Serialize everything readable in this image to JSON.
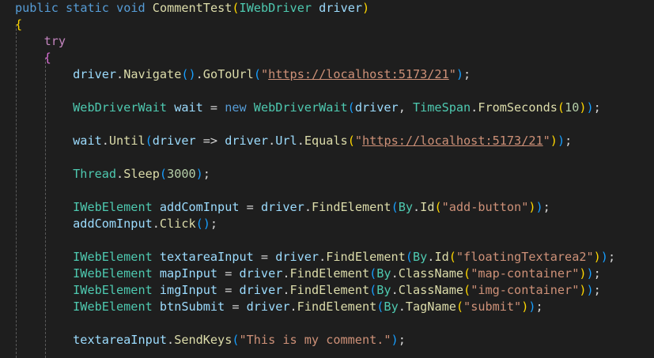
{
  "editor": {
    "language": "csharp",
    "theme": {
      "background": "#1e1e1e",
      "keyword": "#569cd6",
      "control": "#c586c0",
      "type": "#4ec9b0",
      "function": "#dcdcaa",
      "variable": "#9cdcfe",
      "string": "#ce9178",
      "number": "#b5cea8",
      "bracket_level1": "#ffd700",
      "bracket_level2": "#da70d6",
      "bracket_level3": "#179fff"
    },
    "lines": [
      {
        "tokens": [
          {
            "t": "public",
            "c": "kw"
          },
          {
            "t": " ",
            "c": "pl"
          },
          {
            "t": "static",
            "c": "kw"
          },
          {
            "t": " ",
            "c": "pl"
          },
          {
            "t": "void",
            "c": "kw"
          },
          {
            "t": " ",
            "c": "pl"
          },
          {
            "t": "CommentTest",
            "c": "fn"
          },
          {
            "t": "(",
            "c": "b1"
          },
          {
            "t": "IWebDriver",
            "c": "ty"
          },
          {
            "t": " ",
            "c": "pl"
          },
          {
            "t": "driver",
            "c": "var"
          },
          {
            "t": ")",
            "c": "b1"
          }
        ]
      },
      {
        "tokens": [
          {
            "t": "{",
            "c": "b1"
          }
        ]
      },
      {
        "tokens": [
          {
            "t": "    ",
            "c": "pl"
          },
          {
            "t": "try",
            "c": "ctl"
          }
        ]
      },
      {
        "tokens": [
          {
            "t": "    ",
            "c": "pl"
          },
          {
            "t": "{",
            "c": "b2"
          }
        ]
      },
      {
        "tokens": [
          {
            "t": "        ",
            "c": "pl"
          },
          {
            "t": "driver",
            "c": "var"
          },
          {
            "t": ".",
            "c": "pl"
          },
          {
            "t": "Navigate",
            "c": "fn"
          },
          {
            "t": "()",
            "c": "b3"
          },
          {
            "t": ".",
            "c": "pl"
          },
          {
            "t": "GoToUrl",
            "c": "fn"
          },
          {
            "t": "(",
            "c": "b3"
          },
          {
            "t": "\"",
            "c": "str"
          },
          {
            "t": "https://localhost:5173/21",
            "c": "lnk"
          },
          {
            "t": "\"",
            "c": "str"
          },
          {
            "t": ")",
            "c": "b3"
          },
          {
            "t": ";",
            "c": "pl"
          }
        ]
      },
      {
        "tokens": []
      },
      {
        "tokens": [
          {
            "t": "        ",
            "c": "pl"
          },
          {
            "t": "WebDriverWait",
            "c": "ty"
          },
          {
            "t": " ",
            "c": "pl"
          },
          {
            "t": "wait",
            "c": "var"
          },
          {
            "t": " = ",
            "c": "pl"
          },
          {
            "t": "new",
            "c": "kw"
          },
          {
            "t": " ",
            "c": "pl"
          },
          {
            "t": "WebDriverWait",
            "c": "ty"
          },
          {
            "t": "(",
            "c": "b3"
          },
          {
            "t": "driver",
            "c": "var"
          },
          {
            "t": ", ",
            "c": "pl"
          },
          {
            "t": "TimeSpan",
            "c": "ty"
          },
          {
            "t": ".",
            "c": "pl"
          },
          {
            "t": "FromSeconds",
            "c": "fn"
          },
          {
            "t": "(",
            "c": "b1"
          },
          {
            "t": "10",
            "c": "num"
          },
          {
            "t": ")",
            "c": "b1"
          },
          {
            "t": ")",
            "c": "b3"
          },
          {
            "t": ";",
            "c": "pl"
          }
        ]
      },
      {
        "tokens": []
      },
      {
        "tokens": [
          {
            "t": "        ",
            "c": "pl"
          },
          {
            "t": "wait",
            "c": "var"
          },
          {
            "t": ".",
            "c": "pl"
          },
          {
            "t": "Until",
            "c": "fn"
          },
          {
            "t": "(",
            "c": "b3"
          },
          {
            "t": "driver",
            "c": "var"
          },
          {
            "t": " => ",
            "c": "pl"
          },
          {
            "t": "driver",
            "c": "var"
          },
          {
            "t": ".",
            "c": "pl"
          },
          {
            "t": "Url",
            "c": "var"
          },
          {
            "t": ".",
            "c": "pl"
          },
          {
            "t": "Equals",
            "c": "fn"
          },
          {
            "t": "(",
            "c": "b1"
          },
          {
            "t": "\"",
            "c": "str"
          },
          {
            "t": "https://localhost:5173/21",
            "c": "lnk"
          },
          {
            "t": "\"",
            "c": "str"
          },
          {
            "t": ")",
            "c": "b1"
          },
          {
            "t": ")",
            "c": "b3"
          },
          {
            "t": ";",
            "c": "pl"
          }
        ]
      },
      {
        "tokens": []
      },
      {
        "tokens": [
          {
            "t": "        ",
            "c": "pl"
          },
          {
            "t": "Thread",
            "c": "ty"
          },
          {
            "t": ".",
            "c": "pl"
          },
          {
            "t": "Sleep",
            "c": "fn"
          },
          {
            "t": "(",
            "c": "b3"
          },
          {
            "t": "3000",
            "c": "num"
          },
          {
            "t": ")",
            "c": "b3"
          },
          {
            "t": ";",
            "c": "pl"
          }
        ]
      },
      {
        "tokens": []
      },
      {
        "tokens": [
          {
            "t": "        ",
            "c": "pl"
          },
          {
            "t": "IWebElement",
            "c": "ty"
          },
          {
            "t": " ",
            "c": "pl"
          },
          {
            "t": "addComInput",
            "c": "var"
          },
          {
            "t": " = ",
            "c": "pl"
          },
          {
            "t": "driver",
            "c": "var"
          },
          {
            "t": ".",
            "c": "pl"
          },
          {
            "t": "FindElement",
            "c": "fn"
          },
          {
            "t": "(",
            "c": "b3"
          },
          {
            "t": "By",
            "c": "ty"
          },
          {
            "t": ".",
            "c": "pl"
          },
          {
            "t": "Id",
            "c": "fn"
          },
          {
            "t": "(",
            "c": "b1"
          },
          {
            "t": "\"add-button\"",
            "c": "str"
          },
          {
            "t": ")",
            "c": "b1"
          },
          {
            "t": ")",
            "c": "b3"
          },
          {
            "t": ";",
            "c": "pl"
          }
        ]
      },
      {
        "tokens": [
          {
            "t": "        ",
            "c": "pl"
          },
          {
            "t": "addComInput",
            "c": "var"
          },
          {
            "t": ".",
            "c": "pl"
          },
          {
            "t": "Click",
            "c": "fn"
          },
          {
            "t": "()",
            "c": "b3"
          },
          {
            "t": ";",
            "c": "pl"
          }
        ]
      },
      {
        "tokens": []
      },
      {
        "tokens": [
          {
            "t": "        ",
            "c": "pl"
          },
          {
            "t": "IWebElement",
            "c": "ty"
          },
          {
            "t": " ",
            "c": "pl"
          },
          {
            "t": "textareaInput",
            "c": "var"
          },
          {
            "t": " = ",
            "c": "pl"
          },
          {
            "t": "driver",
            "c": "var"
          },
          {
            "t": ".",
            "c": "pl"
          },
          {
            "t": "FindElement",
            "c": "fn"
          },
          {
            "t": "(",
            "c": "b3"
          },
          {
            "t": "By",
            "c": "ty"
          },
          {
            "t": ".",
            "c": "pl"
          },
          {
            "t": "Id",
            "c": "fn"
          },
          {
            "t": "(",
            "c": "b1"
          },
          {
            "t": "\"floatingTextarea2\"",
            "c": "str"
          },
          {
            "t": ")",
            "c": "b1"
          },
          {
            "t": ")",
            "c": "b3"
          },
          {
            "t": ";",
            "c": "pl"
          }
        ]
      },
      {
        "tokens": [
          {
            "t": "        ",
            "c": "pl"
          },
          {
            "t": "IWebElement",
            "c": "ty"
          },
          {
            "t": " ",
            "c": "pl"
          },
          {
            "t": "mapInput",
            "c": "var"
          },
          {
            "t": " = ",
            "c": "pl"
          },
          {
            "t": "driver",
            "c": "var"
          },
          {
            "t": ".",
            "c": "pl"
          },
          {
            "t": "FindElement",
            "c": "fn"
          },
          {
            "t": "(",
            "c": "b3"
          },
          {
            "t": "By",
            "c": "ty"
          },
          {
            "t": ".",
            "c": "pl"
          },
          {
            "t": "ClassName",
            "c": "fn"
          },
          {
            "t": "(",
            "c": "b1"
          },
          {
            "t": "\"map-container\"",
            "c": "str"
          },
          {
            "t": ")",
            "c": "b1"
          },
          {
            "t": ")",
            "c": "b3"
          },
          {
            "t": ";",
            "c": "pl"
          }
        ]
      },
      {
        "tokens": [
          {
            "t": "        ",
            "c": "pl"
          },
          {
            "t": "IWebElement",
            "c": "ty"
          },
          {
            "t": " ",
            "c": "pl"
          },
          {
            "t": "imgInput",
            "c": "var"
          },
          {
            "t": " = ",
            "c": "pl"
          },
          {
            "t": "driver",
            "c": "var"
          },
          {
            "t": ".",
            "c": "pl"
          },
          {
            "t": "FindElement",
            "c": "fn"
          },
          {
            "t": "(",
            "c": "b3"
          },
          {
            "t": "By",
            "c": "ty"
          },
          {
            "t": ".",
            "c": "pl"
          },
          {
            "t": "ClassName",
            "c": "fn"
          },
          {
            "t": "(",
            "c": "b1"
          },
          {
            "t": "\"img-container\"",
            "c": "str"
          },
          {
            "t": ")",
            "c": "b1"
          },
          {
            "t": ")",
            "c": "b3"
          },
          {
            "t": ";",
            "c": "pl"
          }
        ]
      },
      {
        "tokens": [
          {
            "t": "        ",
            "c": "pl"
          },
          {
            "t": "IWebElement",
            "c": "ty"
          },
          {
            "t": " ",
            "c": "pl"
          },
          {
            "t": "btnSubmit",
            "c": "var"
          },
          {
            "t": " = ",
            "c": "pl"
          },
          {
            "t": "driver",
            "c": "var"
          },
          {
            "t": ".",
            "c": "pl"
          },
          {
            "t": "FindElement",
            "c": "fn"
          },
          {
            "t": "(",
            "c": "b3"
          },
          {
            "t": "By",
            "c": "ty"
          },
          {
            "t": ".",
            "c": "pl"
          },
          {
            "t": "TagName",
            "c": "fn"
          },
          {
            "t": "(",
            "c": "b1"
          },
          {
            "t": "\"submit\"",
            "c": "str"
          },
          {
            "t": ")",
            "c": "b1"
          },
          {
            "t": ")",
            "c": "b3"
          },
          {
            "t": ";",
            "c": "pl"
          }
        ]
      },
      {
        "tokens": []
      },
      {
        "tokens": [
          {
            "t": "        ",
            "c": "pl"
          },
          {
            "t": "textareaInput",
            "c": "var"
          },
          {
            "t": ".",
            "c": "pl"
          },
          {
            "t": "SendKeys",
            "c": "fn"
          },
          {
            "t": "(",
            "c": "b3"
          },
          {
            "t": "\"This is my comment.\"",
            "c": "str"
          },
          {
            "t": ")",
            "c": "b3"
          },
          {
            "t": ";",
            "c": "pl"
          }
        ]
      }
    ]
  }
}
